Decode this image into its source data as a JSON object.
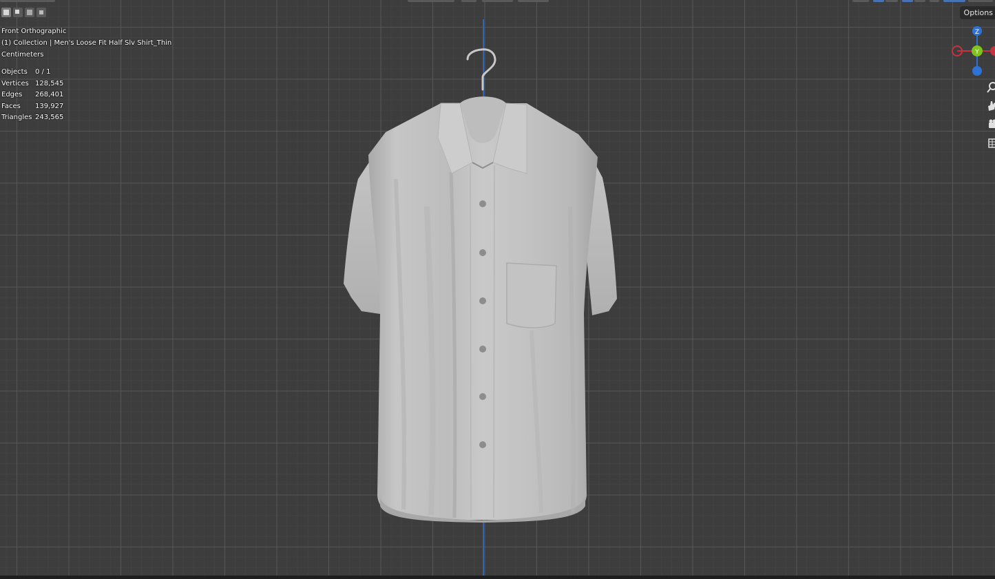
{
  "viewport": {
    "view_name": "Front Orthographic",
    "collection_line": "(1) Collection | Men's Loose Fit Half Slv Shirt_Thin",
    "units": "Centimeters",
    "options_label": "Options"
  },
  "stats": [
    {
      "label": "Objects",
      "value": "0 / 1"
    },
    {
      "label": "Vertices",
      "value": "128,545"
    },
    {
      "label": "Edges",
      "value": "268,401"
    },
    {
      "label": "Faces",
      "value": "139,927"
    },
    {
      "label": "Triangles",
      "value": "243,565"
    }
  ],
  "gizmo": {
    "z_label": "Z",
    "y_label": "Y",
    "x_color": "#c8313f",
    "y_color": "#7fc31c",
    "z_color": "#2f72d6"
  },
  "icons": {
    "select_modes": [
      "select-new-icon",
      "select-extend-icon",
      "select-subtract-icon",
      "select-intersect-icon"
    ],
    "nav_tools": [
      "zoom-icon",
      "pan-hand-icon",
      "camera-view-icon",
      "ortho-grid-icon"
    ]
  },
  "colors": {
    "viewport_bg": "#3d3d3d",
    "axis_blue": "#2f63b8",
    "options_bg": "#2a2a2a"
  }
}
